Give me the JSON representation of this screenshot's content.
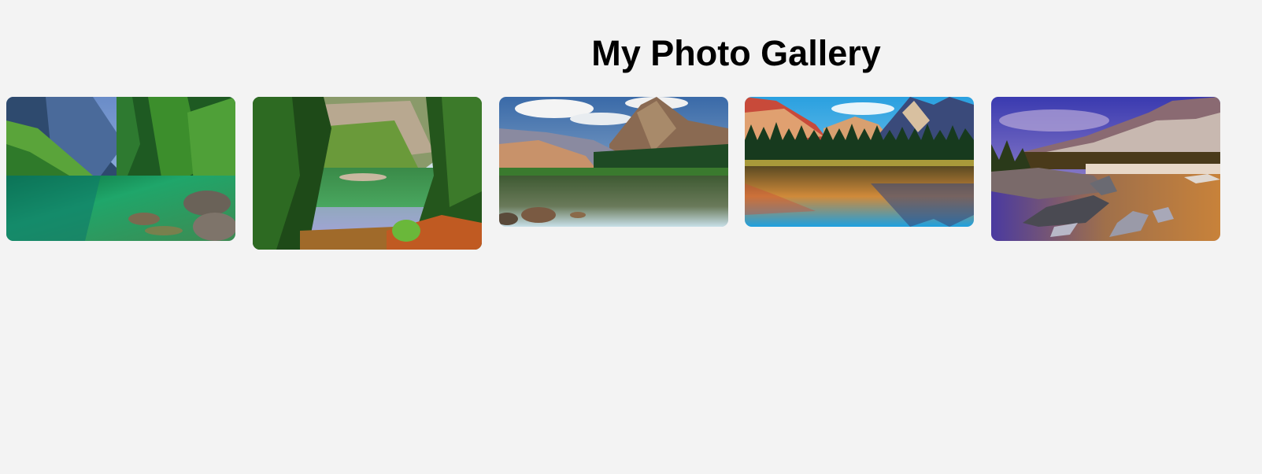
{
  "page": {
    "title": "My Photo Gallery"
  },
  "gallery": {
    "photos": [
      {
        "subject": "mountain-lake-forest-green"
      },
      {
        "subject": "forest-lake-reflection"
      },
      {
        "subject": "cloudy-peak-lake"
      },
      {
        "subject": "pine-forest-mirror-lake"
      },
      {
        "subject": "rocky-lakeshore-sunset"
      }
    ]
  },
  "colors": {
    "background": "#f3f3f3",
    "title": "#000000"
  }
}
